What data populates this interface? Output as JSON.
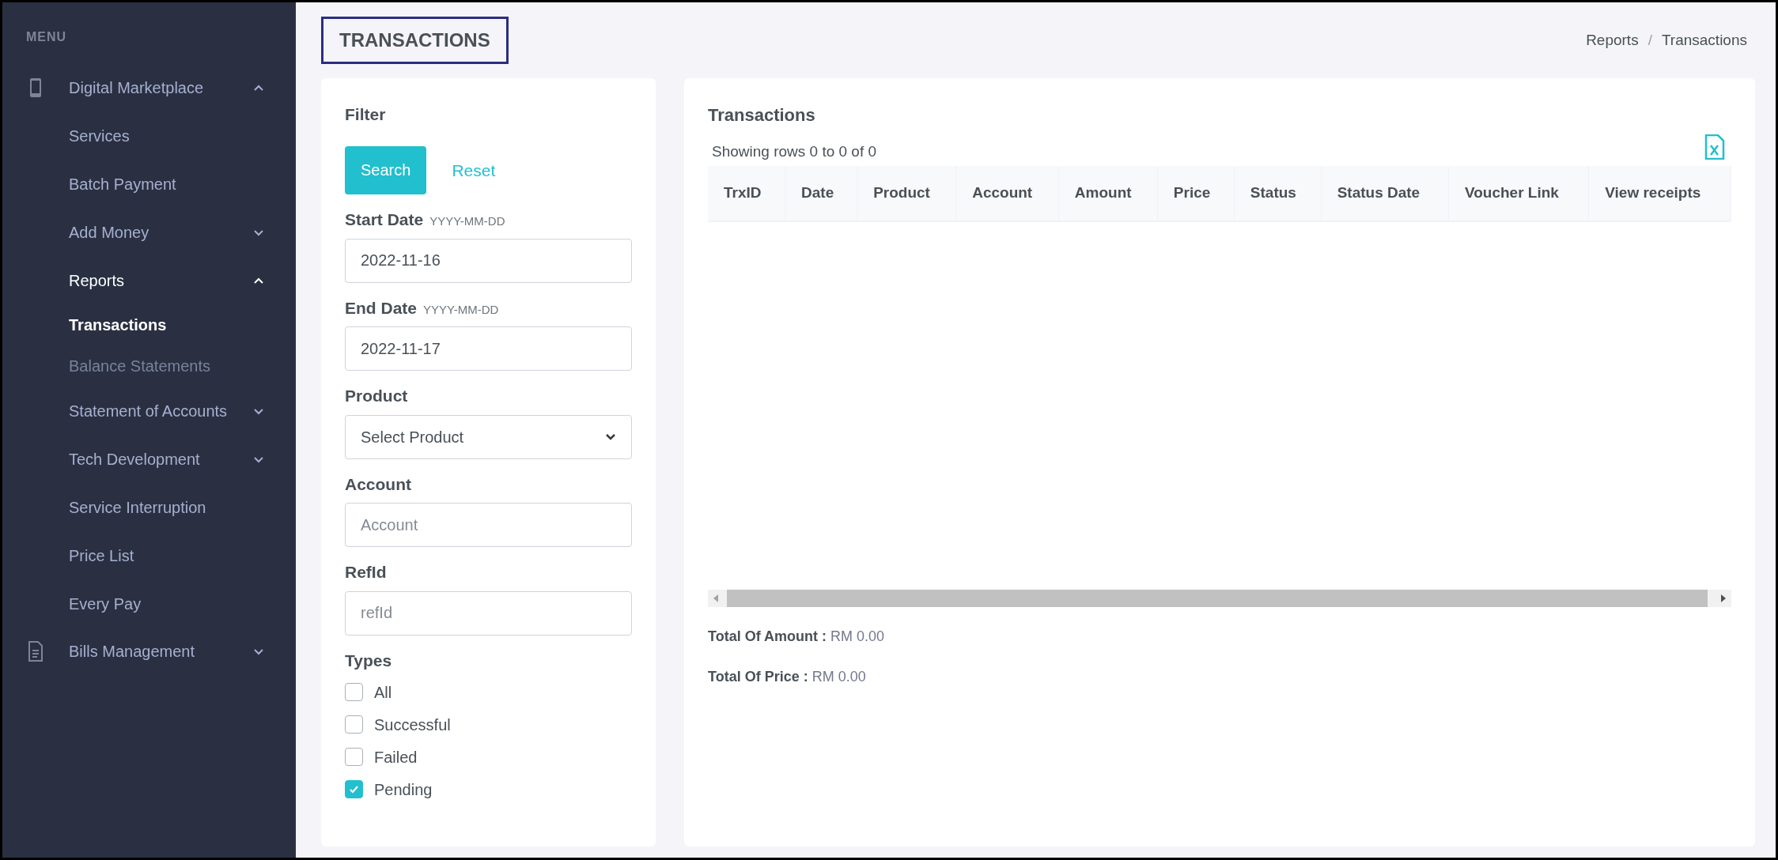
{
  "sidebar": {
    "heading": "MENU",
    "items": [
      {
        "label": "Digital Marketplace",
        "expanded": true,
        "children": [
          {
            "label": "Services",
            "selected": false
          },
          {
            "label": "Batch Payment",
            "selected": false
          },
          {
            "label": "Add Money",
            "expanded": false,
            "selected": false
          },
          {
            "label": "Reports",
            "expanded": true,
            "selected": false,
            "children": [
              {
                "label": "Transactions",
                "selected": true
              },
              {
                "label": "Balance Statements",
                "selected": false
              }
            ]
          },
          {
            "label": "Statement of Accounts",
            "expanded": false,
            "selected": false
          },
          {
            "label": "Tech Development",
            "expanded": false,
            "selected": false
          },
          {
            "label": "Service Interruption",
            "selected": false
          },
          {
            "label": "Price List",
            "selected": false
          },
          {
            "label": "Every Pay",
            "selected": false
          }
        ]
      },
      {
        "label": "Bills Management",
        "expanded": false
      }
    ]
  },
  "page_title": "TRANSACTIONS",
  "breadcrumb": {
    "separator": "/",
    "items": [
      "Reports",
      "Transactions"
    ]
  },
  "filter": {
    "title": "Filter",
    "buttons": {
      "search": "Search",
      "reset": "Reset"
    },
    "fields": [
      {
        "kind": "text",
        "label": "Start Date",
        "hint": "YYYY-MM-DD",
        "value": "2022-11-16"
      },
      {
        "kind": "text",
        "label": "End Date",
        "hint": "YYYY-MM-DD",
        "value": "2022-11-17"
      },
      {
        "kind": "select",
        "label": "Product",
        "value": "Select Product"
      },
      {
        "kind": "text",
        "label": "Account",
        "placeholder": "Account"
      },
      {
        "kind": "text",
        "label": "RefId",
        "placeholder": "refId"
      }
    ],
    "types": {
      "label": "Types",
      "options": [
        {
          "label": "All",
          "checked": false
        },
        {
          "label": "Successful",
          "checked": false
        },
        {
          "label": "Failed",
          "checked": false
        },
        {
          "label": "Pending",
          "checked": true
        }
      ]
    }
  },
  "table": {
    "title": "Transactions",
    "summary": "Showing rows 0 to 0 of 0",
    "columns": [
      "TrxID",
      "Date",
      "Product",
      "Account",
      "Amount",
      "Price",
      "Status",
      "Status Date",
      "Voucher Link",
      "View receipts"
    ]
  },
  "totals": [
    {
      "label": "Total Of Amount :",
      "value": "RM 0.00"
    },
    {
      "label": "Total Of Price :",
      "value": "RM 0.00"
    }
  ]
}
